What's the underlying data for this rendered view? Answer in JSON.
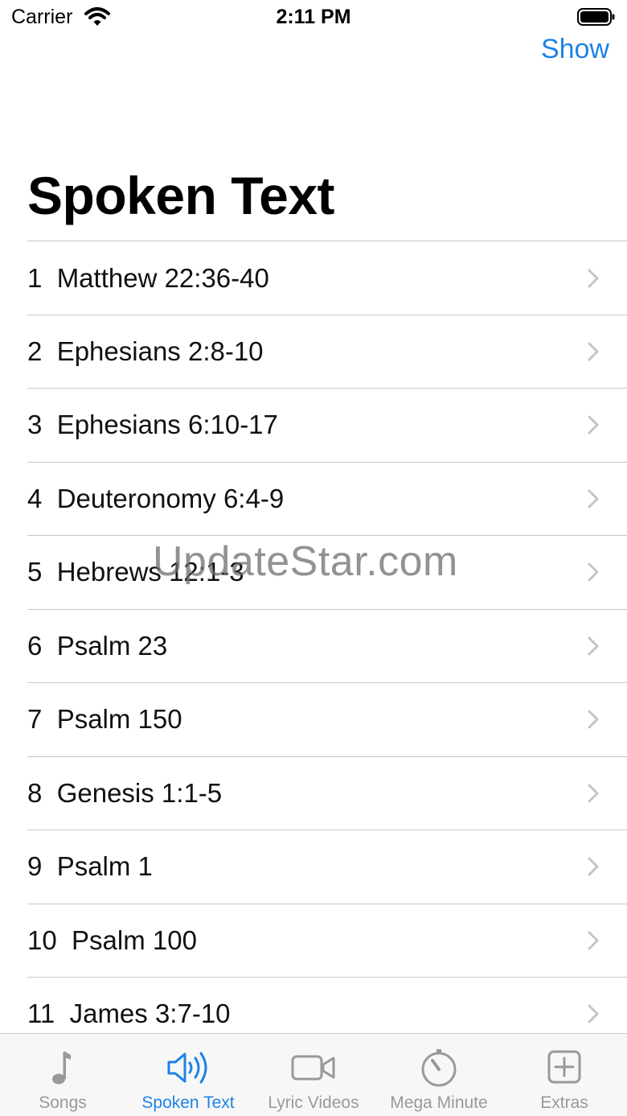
{
  "status_bar": {
    "carrier": "Carrier",
    "time": "2:11 PM"
  },
  "nav": {
    "show_label": "Show",
    "title": "Spoken Text"
  },
  "list": {
    "items": [
      {
        "label": "1  Matthew 22:36-40"
      },
      {
        "label": "2  Ephesians 2:8-10"
      },
      {
        "label": "3  Ephesians 6:10-17"
      },
      {
        "label": "4  Deuteronomy 6:4-9"
      },
      {
        "label": "5  Hebrews 12:1-3"
      },
      {
        "label": "6  Psalm 23"
      },
      {
        "label": "7  Psalm 150"
      },
      {
        "label": "8  Genesis 1:1-5"
      },
      {
        "label": "9  Psalm 1"
      },
      {
        "label": "10  Psalm 100"
      },
      {
        "label": "11  James 3:7-10"
      }
    ]
  },
  "watermark": "UpdateStar.com",
  "tab_bar": {
    "tabs": [
      {
        "label": "Songs",
        "icon": "music-note-icon",
        "active": false
      },
      {
        "label": "Spoken Text",
        "icon": "speaker-wave-icon",
        "active": true
      },
      {
        "label": "Lyric Videos",
        "icon": "video-camera-icon",
        "active": false
      },
      {
        "label": "Mega Minute",
        "icon": "timer-icon",
        "active": false
      },
      {
        "label": "Extras",
        "icon": "plus-square-icon",
        "active": false
      }
    ]
  },
  "colors": {
    "accent": "#1e82e6",
    "inactive_tab": "#999999",
    "separator": "#c8c8cc",
    "chevron": "#c4c4c7"
  }
}
